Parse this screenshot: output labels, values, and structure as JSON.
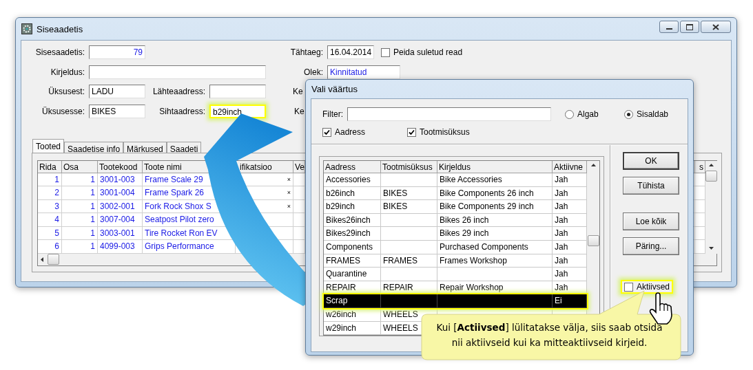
{
  "main_window": {
    "title": "Siseaadetis",
    "document": {
      "label": "Sisesaadetis:",
      "value": "79"
    },
    "due_date": {
      "label": "Tähtaeg:",
      "value": "16.04.2014"
    },
    "hide_closed": {
      "label": "Peida suletud read",
      "checked": false
    },
    "description": {
      "label": "Kirjeldus:"
    },
    "status": {
      "label": "Olek:",
      "value": "Kinnitatud"
    },
    "from_unit": {
      "label": "Üksusest:",
      "value": "LADU"
    },
    "from_address": {
      "label": "Lähteaadress:"
    },
    "label_3": "Ke",
    "to_unit": {
      "label": "Üksusesse:",
      "value": "BIKES"
    },
    "to_address": {
      "label": "Sihtaadress:",
      "value": "b29inch",
      "highlighted": true
    },
    "label_4": "Ke",
    "tabs": [
      {
        "label": "Tooted",
        "selected": true
      },
      {
        "label": "Saadetise info",
        "selected": false
      },
      {
        "label": "Märkused",
        "selected": false
      },
      {
        "label": "Saadeti",
        "selected": false
      }
    ],
    "table": {
      "columns": [
        "Rida",
        "Osa",
        "Tootekood",
        "Toote nimi",
        "ifikatsioo",
        "Ve",
        "s"
      ],
      "rows": [
        [
          "1",
          "1",
          "3001-003",
          "Frame Scale 29",
          "×"
        ],
        [
          "2",
          "1",
          "3001-004",
          "Frame Spark 26",
          "×"
        ],
        [
          "3",
          "1",
          "3002-001",
          "Fork Rock Shox S",
          "×"
        ],
        [
          "4",
          "1",
          "3007-004",
          "Seatpost Pilot zero"
        ],
        [
          "5",
          "1",
          "3003-001",
          "Tire Rocket Ron EV"
        ],
        [
          "6",
          "1",
          "4099-003",
          "Grips Performance"
        ]
      ]
    }
  },
  "dialog": {
    "title": "Vali väärtus",
    "filter": {
      "label": "Filter:"
    },
    "match_modes": [
      {
        "label": "Algab",
        "selected": false
      },
      {
        "label": "Sisaldab",
        "selected": true
      }
    ],
    "search_fields": [
      {
        "label": "Aadress",
        "checked": true
      },
      {
        "label": "Tootmisüksus",
        "checked": true
      }
    ],
    "table": {
      "columns": [
        "Aadress",
        "Tootmisüksus",
        "Kirjeldus",
        "Aktiivne"
      ],
      "rows": [
        {
          "address": "Accessories",
          "description": "Bike Accessories",
          "active": "Jah",
          "selected": false
        },
        {
          "address": "b26inch",
          "unit": "BIKES",
          "description": "Bike Components 26 inch",
          "active": "Jah",
          "selected": false
        },
        {
          "address": "b29inch",
          "unit": "BIKES",
          "description": "Bike Components 29 inch",
          "active": "Jah",
          "selected": false
        },
        {
          "address": "Bikes26inch",
          "description": "Bikes 26 inch",
          "active": "Jah",
          "selected": false
        },
        {
          "address": "Bikes29inch",
          "description": "Bikes 29 inch",
          "active": "Jah",
          "selected": false
        },
        {
          "address": "Components",
          "description": "Purchased Components",
          "active": "Jah",
          "selected": false
        },
        {
          "address": "FRAMES",
          "unit": "FRAMES",
          "description": "Frames Workshop",
          "active": "Jah",
          "selected": false
        },
        {
          "address": "Quarantine",
          "active": "Jah",
          "selected": false
        },
        {
          "address": "REPAIR",
          "unit": "REPAIR",
          "description": "Repair Workshop",
          "active": "Jah",
          "selected": false
        },
        {
          "address": "Scrap",
          "active": "Ei",
          "selected": true
        },
        {
          "address": "w26inch",
          "unit": "WHEELS",
          "selected": false
        },
        {
          "address": "w29inch",
          "unit": "WHEELS",
          "selected": false
        }
      ]
    },
    "buttons": [
      {
        "label": "OK",
        "kind": "default"
      },
      {
        "label": "Tühista",
        "kind": "normal"
      },
      {
        "label": "Loe kõik",
        "kind": "normal"
      },
      {
        "label": "Päring...",
        "kind": "normal"
      }
    ],
    "active_only": {
      "label": "Aktiivsed",
      "checked": false,
      "highlighted": true
    }
  },
  "callout": {
    "text": "Kui [**Actiivsed**] lülitatakse välja, siis saab otsida nii aktiivseid kui ka mitteaktiivseid kirjeid."
  }
}
